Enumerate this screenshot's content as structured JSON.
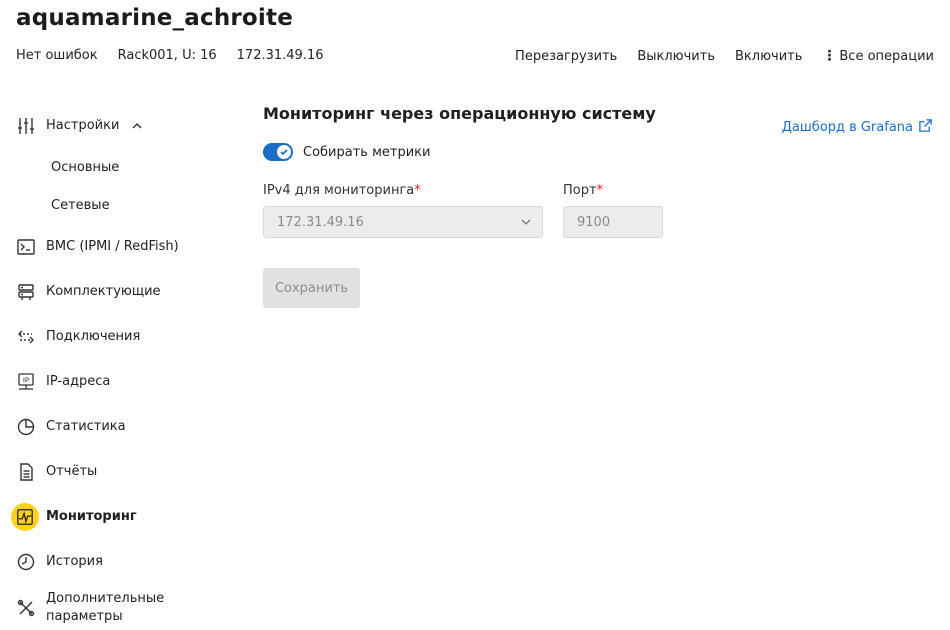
{
  "header": {
    "title": "aquamarine_achroite",
    "status": "Нет ошибок",
    "location": "Rack001, U: 16",
    "ip": "172.31.49.16"
  },
  "actions": {
    "reboot": "Перезагрузить",
    "power_off": "Выключить",
    "power_on": "Включить",
    "all_ops": "Все операции"
  },
  "sidebar": {
    "settings": "Настройки",
    "settings_sub": [
      "Основные",
      "Сетевые"
    ],
    "items": [
      "BMC (IPMI / RedFish)",
      "Комплектующие",
      "Подключения",
      "IP-адреса",
      "Статистика",
      "Отчёты",
      "Мониторинг",
      "История"
    ],
    "extra_line1": "Дополнительные",
    "extra_line2": "параметры",
    "active": "Мониторинг"
  },
  "main": {
    "title": "Мониторинг через операционную систему",
    "grafana_link": "Дашборд в Grafana",
    "collect_metrics_label": "Собирать метрики",
    "collect_metrics_enabled": true,
    "ipv4_label": "IPv4 для мониторинга",
    "ipv4_value": "172.31.49.16",
    "port_label": "Порт",
    "port_value": "9100",
    "required_mark": "*",
    "save_button": "Сохранить"
  },
  "colors": {
    "accent": "#1a6dc7",
    "active_highlight": "#ffd21f",
    "required": "#d22222"
  }
}
